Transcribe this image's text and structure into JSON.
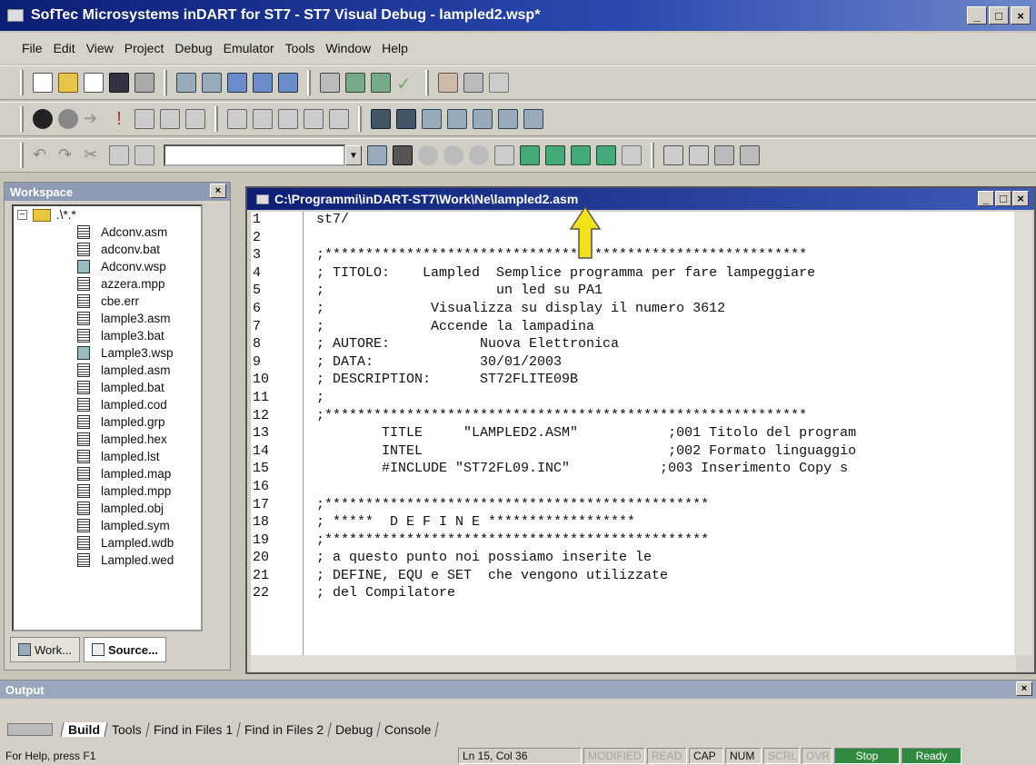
{
  "window": {
    "title": "SofTec Microsystems inDART for ST7 - ST7 Visual Debug - lampled2.wsp*",
    "min": "_",
    "max": "□",
    "close": "×"
  },
  "menu": [
    "File",
    "Edit",
    "View",
    "Project",
    "Debug",
    "Emulator",
    "Tools",
    "Window",
    "Help"
  ],
  "workspace": {
    "title": "Workspace",
    "root": ".\\*.*",
    "files": [
      {
        "name": "Adconv.asm",
        "kind": "doc"
      },
      {
        "name": "adconv.bat",
        "kind": "doc"
      },
      {
        "name": "Adconv.wsp",
        "kind": "wsp"
      },
      {
        "name": "azzera.mpp",
        "kind": "doc"
      },
      {
        "name": "cbe.err",
        "kind": "doc"
      },
      {
        "name": "lample3.asm",
        "kind": "doc"
      },
      {
        "name": "lample3.bat",
        "kind": "doc"
      },
      {
        "name": "Lample3.wsp",
        "kind": "wsp"
      },
      {
        "name": "lampled.asm",
        "kind": "doc"
      },
      {
        "name": "lampled.bat",
        "kind": "doc"
      },
      {
        "name": "lampled.cod",
        "kind": "doc"
      },
      {
        "name": "lampled.grp",
        "kind": "doc"
      },
      {
        "name": "lampled.hex",
        "kind": "doc"
      },
      {
        "name": "lampled.lst",
        "kind": "doc"
      },
      {
        "name": "lampled.map",
        "kind": "doc"
      },
      {
        "name": "lampled.mpp",
        "kind": "doc"
      },
      {
        "name": "lampled.obj",
        "kind": "doc"
      },
      {
        "name": "lampled.sym",
        "kind": "doc"
      },
      {
        "name": "Lampled.wdb",
        "kind": "doc"
      },
      {
        "name": "Lampled.wed",
        "kind": "doc"
      }
    ],
    "tabs": [
      "Work...",
      "Source..."
    ]
  },
  "editor": {
    "title": "C:\\Programmi\\inDART-ST7\\Work\\Ne\\lampled2.asm",
    "lines": [
      {
        "n": "1",
        "t": "st7/"
      },
      {
        "n": "2",
        "t": ""
      },
      {
        "n": "3",
        "t": ";***********************************************************"
      },
      {
        "n": "4",
        "t": "; TITOLO:    Lampled  Semplice programma per fare lampeggiare"
      },
      {
        "n": "5",
        "t": ";                     un led su PA1"
      },
      {
        "n": "6",
        "t": ";             Visualizza su display il numero 3612"
      },
      {
        "n": "7",
        "t": ";             Accende la lampadina"
      },
      {
        "n": "8",
        "t": "; AUTORE:           Nuova Elettronica"
      },
      {
        "n": "9",
        "t": "; DATA:             30/01/2003"
      },
      {
        "n": "10",
        "t": "; DESCRIPTION:      ST72FLITE09B"
      },
      {
        "n": "11",
        "t": ";"
      },
      {
        "n": "12",
        "t": ";***********************************************************"
      },
      {
        "n": "13",
        "t": "        TITLE     \"LAMPLED2.ASM\"           ;001 Titolo del program"
      },
      {
        "n": "14",
        "t": "        INTEL                              ;002 Formato linguaggio"
      },
      {
        "n": "15",
        "t": "        #INCLUDE \"ST72FL09.INC\"           ;003 Inserimento Copy s"
      },
      {
        "n": "16",
        "t": ""
      },
      {
        "n": "17",
        "t": ";***********************************************"
      },
      {
        "n": "18",
        "t": "; *****  D E F I N E ******************"
      },
      {
        "n": "19",
        "t": ";***********************************************"
      },
      {
        "n": "20",
        "t": "; a questo punto noi possiamo inserite le"
      },
      {
        "n": "21",
        "t": "; DEFINE, EQU e SET  che vengono utilizzate"
      },
      {
        "n": "22",
        "t": "; del Compilatore"
      }
    ]
  },
  "output": {
    "title": "Output",
    "tabs": [
      "Build",
      "Tools",
      "Find in Files 1",
      "Find in Files 2",
      "Debug",
      "Console"
    ]
  },
  "status": {
    "help": "For Help, press F1",
    "pos": "Ln 15, Col 36",
    "modified": "MODIFIED",
    "read": "READ",
    "cap": "CAP",
    "num": "NUM",
    "scrl": "SCRL",
    "ovr": "OVR",
    "stop": "Stop",
    "ready": "Ready"
  },
  "colors": {
    "title_bar": "#0c1e74",
    "status_green": "#2f8a3d",
    "arrow": "#f2e21a"
  }
}
